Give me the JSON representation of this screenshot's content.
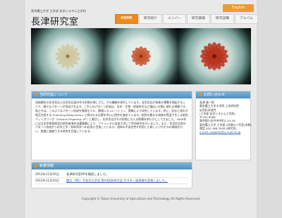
{
  "header": {
    "lang_button": "English",
    "affiliation": "東京農工大学 工学部 化学システム工学科",
    "title": "長津研究室"
  },
  "nav": [
    {
      "label": "HOME",
      "active": true
    },
    {
      "label": "研究紹介",
      "active": false
    },
    {
      "label": "メンバー",
      "active": false
    },
    {
      "label": "研究業績",
      "active": false
    },
    {
      "label": "研究設備",
      "active": false
    },
    {
      "label": "アルバム",
      "active": false
    }
  ],
  "hero": {
    "dishes": [
      {
        "icon": "petri-dish-pattern-icon",
        "petal_color": "#cfc7a0"
      },
      {
        "icon": "petri-dish-pattern-icon",
        "petal_color": "#c7572f"
      },
      {
        "icon": "petri-dish-pattern-icon",
        "petal_color": "#b8321c"
      }
    ]
  },
  "about": {
    "heading": "当研究室について",
    "body": "流体解析の化学反応と化学反応流の作る形態の美しさと、その機能を研究しています。化学反応が流体の運動を誘起することで、様々なパターンが形成されます。これらのパターン形成は、化学・生物・地球科学など幅広い分野に現れる現象です。私たちは、このようなパターン形成を数理モデル、数値シミュレーション、実験により研究しています。特に、反応と流れが相互作用する Chemohydrodynamics と呼ばれる分野を中心に研究を進めています。粘性の異なる流体の界面で生じる粘性フィンガリング（Viscous Fingering: VF）に着目し、化学反応がその形態に与える影響を明らかにしてきました。2009年には日本学術振興会の研究者海外派遣事業により、ブリュッセル自由大学にて共同研究を行いました。また、化学反応系のパターン形成から化学工学・材料科学への応用も目指しています。流体の不安定性を利用した新しいプロセスの開発を行い、産業に貢献できる研究を目指しています。"
  },
  "contact": {
    "heading": "お問い合わせ",
    "lines": [
      "長津 雄一郎",
      "東京農工大学大学院 工学研究院",
      "応用化学部門",
      "(工学部 化学システム工学科)",
      "〒184-8588",
      "東京都小金井市中町2-24-16",
      "東京農工大学 工学部 4号館317号室(本館)",
      "電話 042-388-7658 (研究室)",
      "e-mail: nagatsu@cc.tuat.ac.jp"
    ],
    "email_line_index": 8
  },
  "news": {
    "heading": "新着情報",
    "items": [
      {
        "date": "2012年11月16日",
        "text": "長津研究室HPを開設しました。",
        "link": false
      },
      {
        "date": "2012年11月16日",
        "text": "論文（M1）が化学工学会 第44回秋季大会 ポスター発表賞を受賞しました。",
        "link": true
      }
    ]
  },
  "footer": {
    "text": "Copyright © Tokyo University of Agriculture and Technology All Rights Reserved."
  }
}
